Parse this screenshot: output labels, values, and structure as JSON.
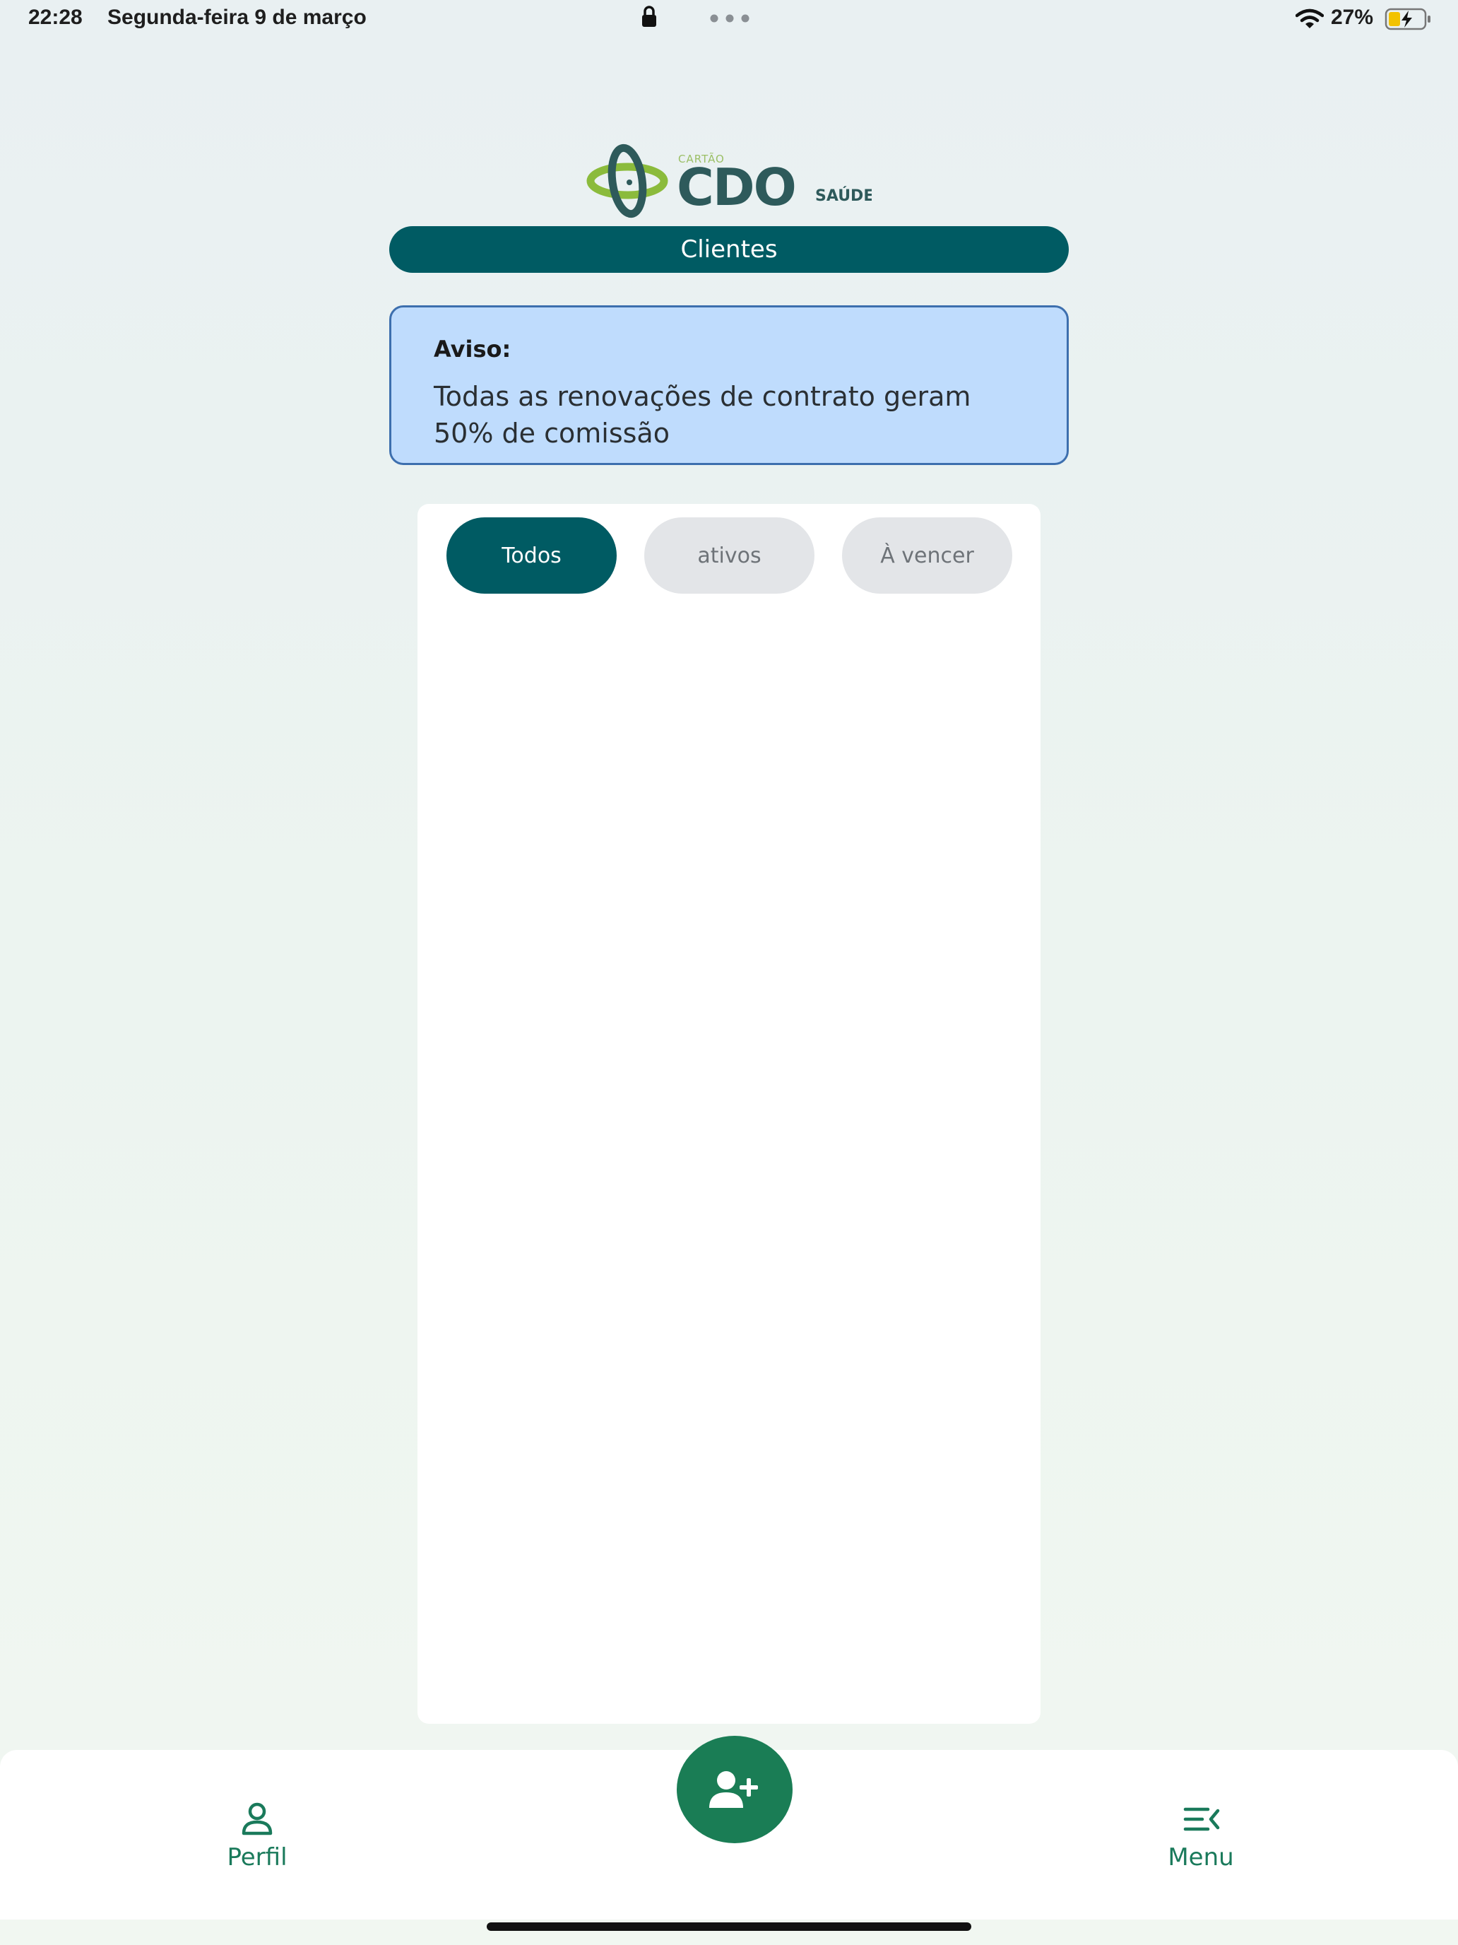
{
  "status_bar": {
    "time": "22:28",
    "date": "Segunda-feira 9 de março",
    "battery": "27%",
    "icons": [
      "lock-icon",
      "multitasking-dots-icon",
      "wifi-icon",
      "battery-charging-icon"
    ]
  },
  "logo": {
    "small": "CARTÃO",
    "main": "CDO",
    "suffix": "SAÚDE"
  },
  "header": {
    "title": "Clientes"
  },
  "notice": {
    "title": "Aviso:",
    "text": "Todas as renovações de contrato geram 50% de comissão"
  },
  "filters": [
    {
      "label": "Todos",
      "selected": true
    },
    {
      "label": "ativos",
      "selected": false
    },
    {
      "label": "À vencer",
      "selected": false
    }
  ],
  "bottom_nav": {
    "profile_label": "Perfil",
    "menu_label": "Menu",
    "fab_icon": "add-user-icon"
  },
  "colors": {
    "primary": "#005b63",
    "accent_green": "#1a7d55",
    "notice_bg": "#bfdcfd",
    "notice_border": "#3d6fae",
    "logo_lime": "#8bbb3c"
  }
}
